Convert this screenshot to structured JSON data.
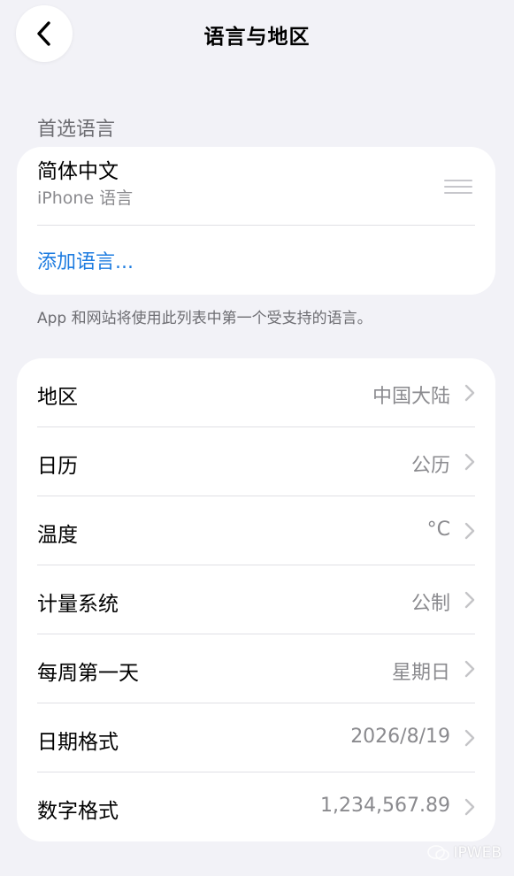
{
  "header": {
    "title": "语言与地区"
  },
  "preferred": {
    "section_title": "首选语言",
    "language_name": "简体中文",
    "language_sub": "iPhone 语言",
    "add_label": "添加语言...",
    "footnote": "App 和网站将使用此列表中第一个受支持的语言。"
  },
  "settings": {
    "rows": [
      {
        "label": "地区",
        "value": "中国大陆"
      },
      {
        "label": "日历",
        "value": "公历"
      },
      {
        "label": "温度",
        "value": "°C"
      },
      {
        "label": "计量系统",
        "value": "公制"
      },
      {
        "label": "每周第一天",
        "value": "星期日"
      },
      {
        "label": "日期格式",
        "value": "2026/8/19"
      },
      {
        "label": "数字格式",
        "value": "1,234,567.89"
      }
    ]
  },
  "watermark": {
    "text": "IPWEB"
  },
  "colors": {
    "accent": "#1E7CE0",
    "background": "#F2F2F7",
    "secondary_text": "#8A8A8E"
  }
}
